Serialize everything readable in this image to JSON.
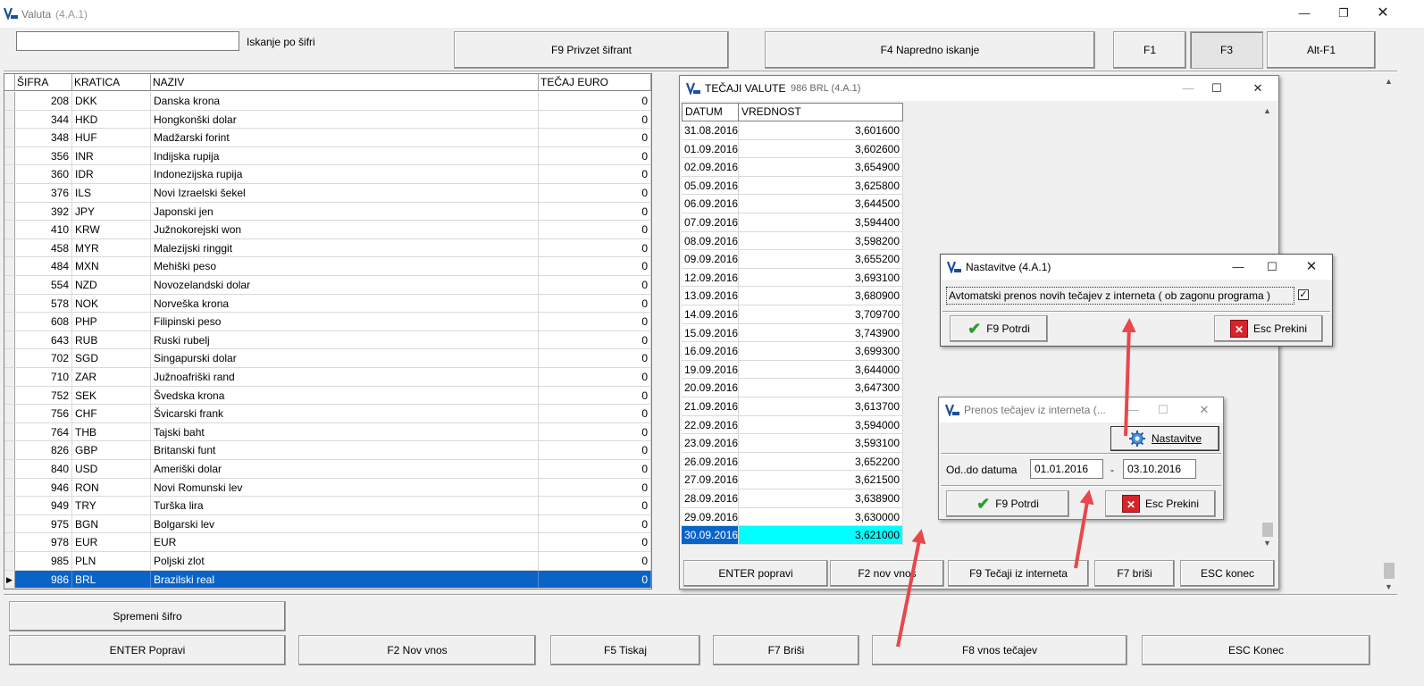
{
  "main_window": {
    "title": "Valuta",
    "version": "(4.A.1)",
    "search_value": "",
    "search_label": "Iskanje po šifri",
    "toolbar": {
      "f9_privzet": "F9 Privzet šifrant",
      "f4_napredno": "F4  Napredno iskanje",
      "f1": "F1",
      "f3": "F3",
      "altf1": "Alt-F1"
    },
    "columns": [
      "ŠIFRA",
      "KRATICA",
      "NAZIV",
      "TEČAJ EURO"
    ],
    "rows": [
      {
        "sifra": "208",
        "kratica": "DKK",
        "naziv": "Danska krona",
        "tecaj": "0"
      },
      {
        "sifra": "344",
        "kratica": "HKD",
        "naziv": "Hongkonški dolar",
        "tecaj": "0"
      },
      {
        "sifra": "348",
        "kratica": "HUF",
        "naziv": "Madžarski forint",
        "tecaj": "0"
      },
      {
        "sifra": "356",
        "kratica": "INR",
        "naziv": "Indijska rupija",
        "tecaj": "0"
      },
      {
        "sifra": "360",
        "kratica": "IDR",
        "naziv": "Indonezijska rupija",
        "tecaj": "0"
      },
      {
        "sifra": "376",
        "kratica": "ILS",
        "naziv": "Novi Izraelski šekel",
        "tecaj": "0"
      },
      {
        "sifra": "392",
        "kratica": "JPY",
        "naziv": "Japonski jen",
        "tecaj": "0"
      },
      {
        "sifra": "410",
        "kratica": "KRW",
        "naziv": "Južnokorejski won",
        "tecaj": "0"
      },
      {
        "sifra": "458",
        "kratica": "MYR",
        "naziv": "Malezijski ringgit",
        "tecaj": "0"
      },
      {
        "sifra": "484",
        "kratica": "MXN",
        "naziv": "Mehiški peso",
        "tecaj": "0"
      },
      {
        "sifra": "554",
        "kratica": "NZD",
        "naziv": "Novozelandski dolar",
        "tecaj": "0"
      },
      {
        "sifra": "578",
        "kratica": "NOK",
        "naziv": "Norveška krona",
        "tecaj": "0"
      },
      {
        "sifra": "608",
        "kratica": "PHP",
        "naziv": "Filipinski peso",
        "tecaj": "0"
      },
      {
        "sifra": "643",
        "kratica": "RUB",
        "naziv": "Ruski rubelj",
        "tecaj": "0"
      },
      {
        "sifra": "702",
        "kratica": "SGD",
        "naziv": "Singapurski dolar",
        "tecaj": "0"
      },
      {
        "sifra": "710",
        "kratica": "ZAR",
        "naziv": "Južnoafriški rand",
        "tecaj": "0"
      },
      {
        "sifra": "752",
        "kratica": "SEK",
        "naziv": "Švedska krona",
        "tecaj": "0"
      },
      {
        "sifra": "756",
        "kratica": "CHF",
        "naziv": "Švicarski frank",
        "tecaj": "0"
      },
      {
        "sifra": "764",
        "kratica": "THB",
        "naziv": "Tajski baht",
        "tecaj": "0"
      },
      {
        "sifra": "826",
        "kratica": "GBP",
        "naziv": "Britanski funt",
        "tecaj": "0"
      },
      {
        "sifra": "840",
        "kratica": "USD",
        "naziv": "Ameriški dolar",
        "tecaj": "0"
      },
      {
        "sifra": "946",
        "kratica": "RON",
        "naziv": "Novi Romunski lev",
        "tecaj": "0"
      },
      {
        "sifra": "949",
        "kratica": "TRY",
        "naziv": "Turška lira",
        "tecaj": "0"
      },
      {
        "sifra": "975",
        "kratica": "BGN",
        "naziv": "Bolgarski lev",
        "tecaj": "0"
      },
      {
        "sifra": "978",
        "kratica": "EUR",
        "naziv": "EUR",
        "tecaj": "0"
      },
      {
        "sifra": "985",
        "kratica": "PLN",
        "naziv": "Poljski zlot",
        "tecaj": "0"
      },
      {
        "sifra": "986",
        "kratica": "BRL",
        "naziv": "Brazilski real",
        "tecaj": "0",
        "selected": true
      }
    ],
    "bottom": {
      "spremeni": "Spremeni šifro",
      "enter": "ENTER Popravi",
      "f2": "F2 Nov vnos",
      "f5": "F5 Tiskaj",
      "f7": "F7 Briši",
      "f8": "F8 vnos tečajev",
      "esc": "ESC Konec"
    }
  },
  "tecaji_window": {
    "title": "TEČAJI VALUTE",
    "subtitle": "986 BRL  (4.A.1)",
    "columns": [
      "DATUM",
      "VREDNOST"
    ],
    "rows": [
      {
        "datum": "31.08.2016",
        "vrednost": "3,601600"
      },
      {
        "datum": "01.09.2016",
        "vrednost": "3,602600"
      },
      {
        "datum": "02.09.2016",
        "vrednost": "3,654900"
      },
      {
        "datum": "05.09.2016",
        "vrednost": "3,625800"
      },
      {
        "datum": "06.09.2016",
        "vrednost": "3,644500"
      },
      {
        "datum": "07.09.2016",
        "vrednost": "3,594400"
      },
      {
        "datum": "08.09.2016",
        "vrednost": "3,598200"
      },
      {
        "datum": "09.09.2016",
        "vrednost": "3,655200"
      },
      {
        "datum": "12.09.2016",
        "vrednost": "3,693100"
      },
      {
        "datum": "13.09.2016",
        "vrednost": "3,680900"
      },
      {
        "datum": "14.09.2016",
        "vrednost": "3,709700"
      },
      {
        "datum": "15.09.2016",
        "vrednost": "3,743900"
      },
      {
        "datum": "16.09.2016",
        "vrednost": "3,699300"
      },
      {
        "datum": "19.09.2016",
        "vrednost": "3,644000"
      },
      {
        "datum": "20.09.2016",
        "vrednost": "3,647300"
      },
      {
        "datum": "21.09.2016",
        "vrednost": "3,613700"
      },
      {
        "datum": "22.09.2016",
        "vrednost": "3,594000"
      },
      {
        "datum": "23.09.2016",
        "vrednost": "3,593100"
      },
      {
        "datum": "26.09.2016",
        "vrednost": "3,652200"
      },
      {
        "datum": "27.09.2016",
        "vrednost": "3,621500"
      },
      {
        "datum": "28.09.2016",
        "vrednost": "3,638900"
      },
      {
        "datum": "29.09.2016",
        "vrednost": "3,630000"
      },
      {
        "datum": "30.09.2016",
        "vrednost": "3,621000",
        "selected": true
      }
    ],
    "buttons": {
      "enter": "ENTER popravi",
      "f2": "F2   nov vnos",
      "f9": "F9 Tečaji iz interneta",
      "f7": "F7 briši",
      "esc": "ESC  konec"
    }
  },
  "nastavitve_dialog": {
    "title": "Nastavitve  (4.A.1)",
    "checkbox_label": "Avtomatski prenos novih tečajev z interneta ( ob zagonu programa )",
    "checkbox_checked": true,
    "potrdi": "F9 Potrdi",
    "prekini": "Esc Prekini"
  },
  "prenos_dialog": {
    "title": "Prenos tečajev iz interneta  (...",
    "nastavitve_btn": "Nastavitve",
    "od_do_label": "Od..do datuma",
    "od": "01.01.2016",
    "dash": "-",
    "do": "03.10.2016",
    "potrdi": "F9 Potrdi",
    "prekini": "Esc Prekini"
  },
  "colors": {
    "selection": "#0a64c8",
    "value_highlight": "#00ffff",
    "arrow": "#e8474c"
  }
}
